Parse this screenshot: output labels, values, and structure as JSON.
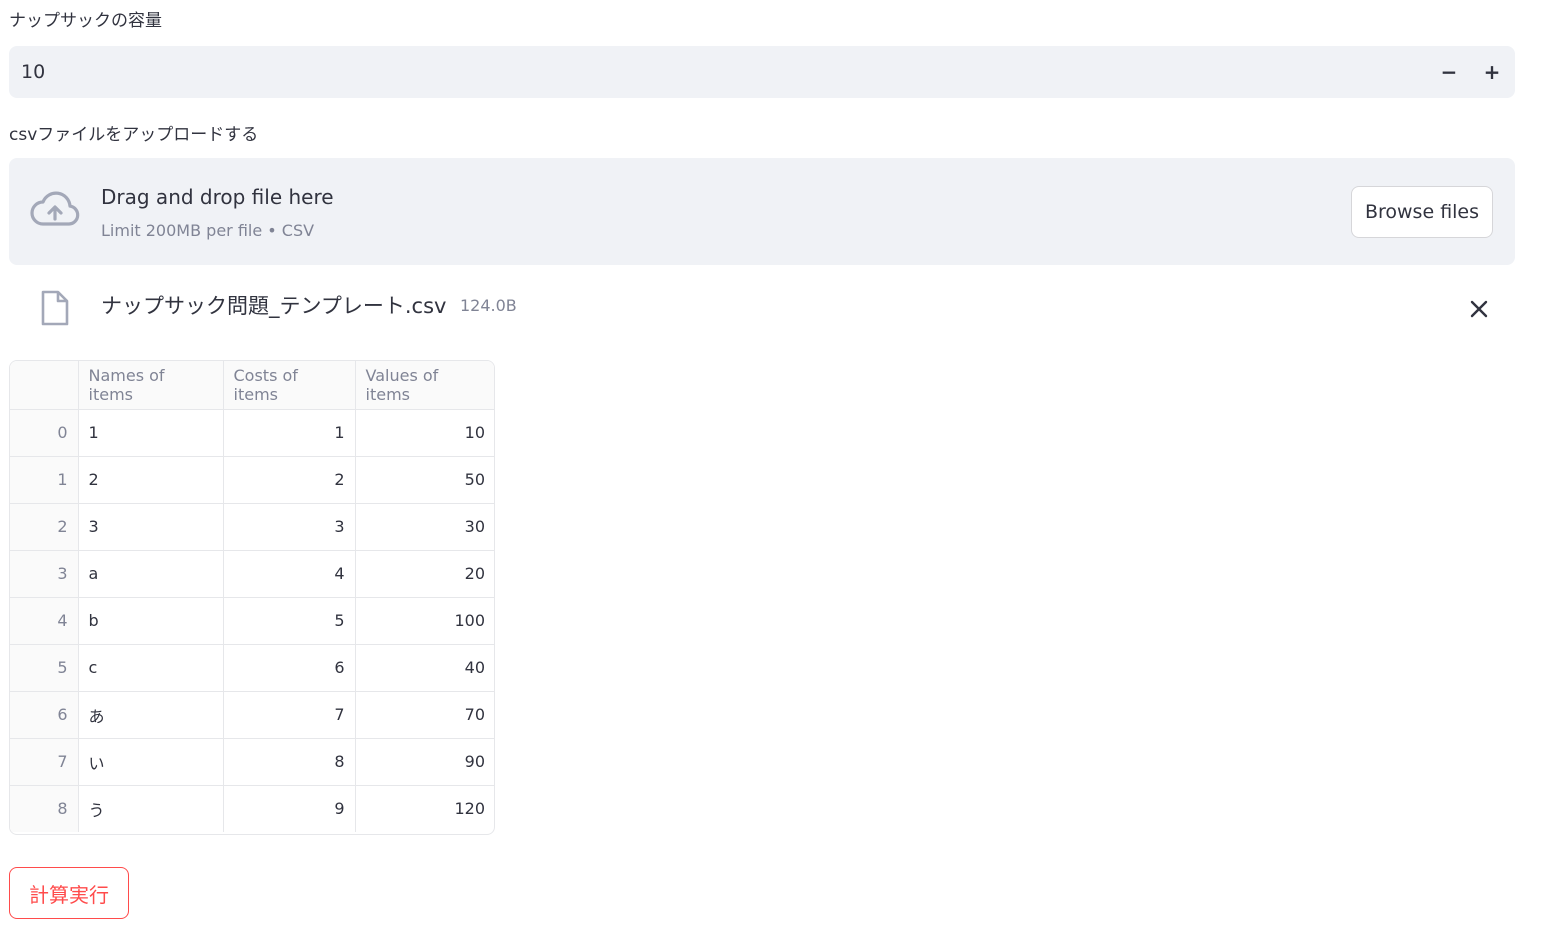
{
  "capacity": {
    "label": "ナップサックの容量",
    "value": "10",
    "decrement_label": "−",
    "increment_label": "+"
  },
  "upload": {
    "label": "csvファイルをアップロードする",
    "dropzone_title": "Drag and drop file here",
    "dropzone_subtitle": "Limit 200MB per file • CSV",
    "browse_label": "Browse files",
    "file": {
      "name": "ナップサック問題_テンプレート.csv",
      "size": "124.0B"
    }
  },
  "table": {
    "columns": [
      "",
      "Names of items",
      "Costs of items",
      "Values of items"
    ],
    "rows": [
      {
        "index": "0",
        "name": "1",
        "cost": "1",
        "value": "10"
      },
      {
        "index": "1",
        "name": "2",
        "cost": "2",
        "value": "50"
      },
      {
        "index": "2",
        "name": "3",
        "cost": "3",
        "value": "30"
      },
      {
        "index": "3",
        "name": "a",
        "cost": "4",
        "value": "20"
      },
      {
        "index": "4",
        "name": "b",
        "cost": "5",
        "value": "100"
      },
      {
        "index": "5",
        "name": "c",
        "cost": "6",
        "value": "40"
      },
      {
        "index": "6",
        "name": "あ",
        "cost": "7",
        "value": "70"
      },
      {
        "index": "7",
        "name": "い",
        "cost": "8",
        "value": "90"
      },
      {
        "index": "8",
        "name": "う",
        "cost": "9",
        "value": "120"
      }
    ]
  },
  "run_button": {
    "label": "計算実行"
  },
  "colors": {
    "accent": "#ff4b4b",
    "input_bg": "#f0f2f6",
    "text": "#31333f",
    "muted": "#808495"
  }
}
